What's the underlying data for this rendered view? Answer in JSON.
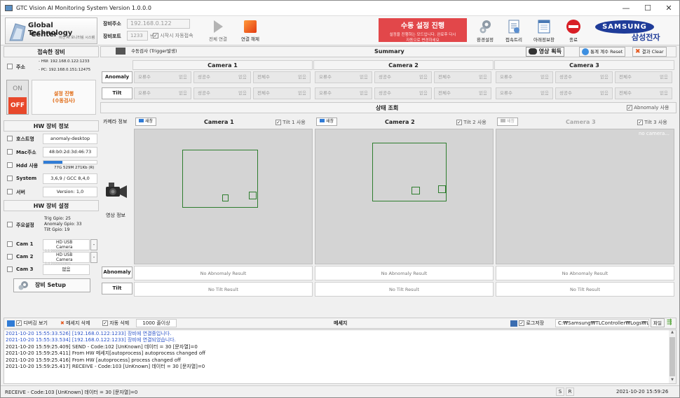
{
  "window": {
    "title": "GTC Vision AI Monitoring System Version 1.0.0.0",
    "min": "—",
    "max": "☐",
    "close": "✕"
  },
  "logo": {
    "line1": "Global Technology",
    "line2": "Center",
    "sub": "비전 AI 모니터링 시스템"
  },
  "conn": {
    "addr_label": "장비주소",
    "addr_value": "192.168.0.122",
    "port_label": "장비포트",
    "port_value": "1233",
    "port_unit": "번",
    "autostart": "시작시 자동접속",
    "connect": "전체 연결",
    "disconnect": "연결 해제"
  },
  "alert": {
    "title": "수동 설정 진행",
    "msg1": "설정을 진행하는 모드입니다. 완료후 다시",
    "msg2": "자동으로 변경하세요"
  },
  "toolbar": {
    "settings": "환경설정",
    "conn_tree": "접속트리",
    "report": "아래정보창",
    "exit": "종료",
    "brand": "SAMSUNG",
    "brand_kr": "삼성전자"
  },
  "side": {
    "connected_title": "접속한 장비",
    "addr_label": "주소",
    "hw_addr": "- HW: 192.168.0.122:1233",
    "pc_addr": "- PC: 192.168.0.151:12475",
    "on": "ON",
    "off": "OFF",
    "mode1": "설정 진행",
    "mode2": "(수동검사)",
    "hwinfo_title": "HW 장비 정보",
    "hostname_label": "호스트명",
    "hostname": "anomaly-desktop",
    "mac_label": "Mac주소",
    "mac": "48:b0:2d:3d:46:73",
    "hdd_label": "Hdd 사용",
    "hdd": "77G 529M 271Kb (R)",
    "hdd_fill": 0.35,
    "system_label": "System",
    "system": "3,6,9 / GCC 8,4,0",
    "server_label": "서버",
    "server": "Version: 1,0",
    "hwset_title": "HW 장비 설정",
    "main_label": "주요설정",
    "trig": "Trig Gpio: 25",
    "anom": "Anomaly Gpio: 33",
    "tilt": "Tilt Gpio: 19",
    "cam1_label": "Cam 1",
    "cam1": "HD USB Camera",
    "cam1_sub": "1.1     2020040801",
    "cam2_label": "Cam 2",
    "cam2": "HD USB Camera",
    "cam2_sub": "1.4     2020040801",
    "cam3_label": "Cam 3",
    "cam3": "없음",
    "setup": "장비 Setup"
  },
  "summary": {
    "trigger_btn": "수동검사 (Trigger발생)",
    "title": "Summary",
    "acquire": "영상 획득",
    "reset": "통계 계수 Reset",
    "clear": "결과 Clear",
    "cams": [
      "Camera 1",
      "Camera 2",
      "Camera 3"
    ],
    "rows": [
      "Anomaly",
      "Tilt"
    ],
    "cols": [
      "오류수",
      "성공수",
      "전체수"
    ],
    "unit": "없음"
  },
  "status": {
    "title": "상태 조회",
    "abnormal_use": "Abnomaly 사용",
    "camera_info": "카메라 정보",
    "image_info": "영상 정보",
    "refresh": "새창",
    "cams": [
      {
        "name": "Camera 1",
        "tilt": "Tilt 1 사용"
      },
      {
        "name": "Camera 2",
        "tilt": "Tilt 2 사용"
      },
      {
        "name": "Camera 3",
        "tilt": "Tilt 3 사용",
        "overlay": "no camera..."
      }
    ],
    "anomaly_label": "Abnomaly",
    "tilt_label": "Tilt",
    "no_anomaly": "No Abnomaly Result",
    "no_tilt": "No Tilt Result"
  },
  "msgbar": {
    "debug": "디버깅 보기",
    "delete": "메세지 삭제",
    "autodel": "자동 삭제",
    "lines": "1000 줄이상",
    "title": "메세지",
    "logsave": "로그저장",
    "logpath": "C:₩Samsung₩TLController₩Logs₩Lo",
    "file": "파일"
  },
  "log": [
    {
      "text": "2021-10-20 15:55:33.526] [192.168.0.122:1233] 장비에 연결중입니다.",
      "color": "#2c54c8"
    },
    {
      "text": "2021-10-20 15:55:33.534] [192.168.0.122:1233] 장비에 연결되었습니다.",
      "color": "#2c54c8"
    },
    {
      "text": "2021-10-20 15:59:25.409] SEND - Code:102 [UnKnown] 데이터 = 30 [문자열]=0",
      "color": "#222222"
    },
    {
      "text": "2021-10-20 15:59:25.411] From HW 메세지[autoprocess] autoprocess changed off",
      "color": "#222222"
    },
    {
      "text": "2021-10-20 15:59:25.416] From HW [autoprocess] process changed off",
      "color": "#222222"
    },
    {
      "text": "2021-10-20 15:59:25.417] RECEIVE - Code:103 [UnKnown] 데이터 = 30 [문자열]=0",
      "color": "#222222"
    }
  ],
  "statusbar": {
    "text": "RECEIVE - Code:103 [UnKnown] 데이터 = 30 [문자열]=0",
    "s": "S",
    "r": "R",
    "time": "2021-10-20 15:59:26"
  }
}
